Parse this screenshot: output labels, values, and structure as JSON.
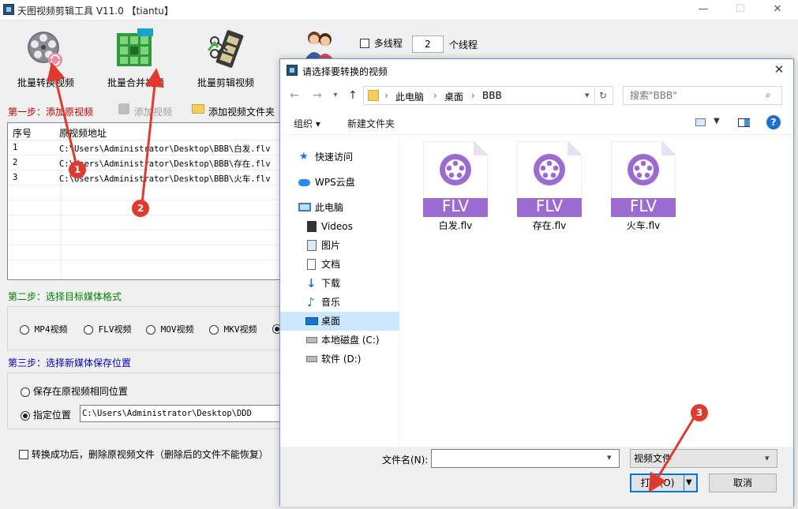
{
  "app": {
    "title": "天图视频剪辑工具 V11.0  【tiantu】",
    "minimize_glyph": "—",
    "maximize_glyph": "☐",
    "close_glyph": "✕"
  },
  "toolbar": {
    "batch_convert": "批量转换视频",
    "batch_merge": "批量合并视频",
    "batch_edit": "批量剪辑视频",
    "multithread_label": "多线程",
    "thread_count": "2",
    "thread_unit": "个线程"
  },
  "step1": {
    "title": "第一步：添加原视频",
    "add_video": "添加视频",
    "add_folder": "添加视频文件夹"
  },
  "table": {
    "col_index": "序号",
    "col_path": "原视频地址",
    "rows": [
      {
        "index": "1",
        "path": "C:\\Users\\Administrator\\Desktop\\BBB\\白发.flv"
      },
      {
        "index": "2",
        "path": "C:\\Users\\Administrator\\Desktop\\BBB\\存在.flv"
      },
      {
        "index": "3",
        "path": "C:\\Users\\Administrator\\Desktop\\BBB\\火车.flv"
      }
    ]
  },
  "step2": {
    "title": "第二步：选择目标媒体格式",
    "formats": [
      "MP4视频",
      "FLV视频",
      "MOV视频",
      "MKV视频"
    ]
  },
  "step3": {
    "title": "第三步：选择新媒体保存位置",
    "same_location": "保存在原视频相同位置",
    "custom_location": "指定位置",
    "path": "C:\\Users\\Administrator\\Desktop\\DDD"
  },
  "delete_option": "转换成功后，删除原视频文件（删除后的文件不能恢复）",
  "annotations": [
    "1",
    "2",
    "3"
  ],
  "dialog": {
    "title": "请选择要转换的视频",
    "close_glyph": "✕",
    "breadcrumb": [
      "此电脑",
      "桌面",
      "BBB"
    ],
    "search_placeholder": "搜索\"BBB\"",
    "organize": "组织 ▾",
    "new_folder": "新建文件夹",
    "help_glyph": "?",
    "nav": {
      "quick_access": "快速访问",
      "wps_cloud": "WPS云盘",
      "this_pc": "此电脑",
      "videos": "Videos",
      "pictures": "图片",
      "documents": "文档",
      "downloads": "下载",
      "music": "音乐",
      "desktop": "桌面",
      "local_disk": "本地磁盘 (C:)",
      "software_disk": "软件 (D:)"
    },
    "files": [
      {
        "name": "白发.flv",
        "ext": "FLV"
      },
      {
        "name": "存在.flv",
        "ext": "FLV"
      },
      {
        "name": "火车.flv",
        "ext": "FLV"
      }
    ],
    "filename_label": "文件名(N):",
    "filename_value": "",
    "filetype": "视频文件",
    "open_button": "打开(O)",
    "cancel_button": "取消"
  },
  "colors": {
    "flv_purple": "#9b6bd1",
    "badge_red": "#e03a2e",
    "step1_red": "#c00000",
    "step2_green": "#008000",
    "step3_blue": "#0000c0"
  }
}
